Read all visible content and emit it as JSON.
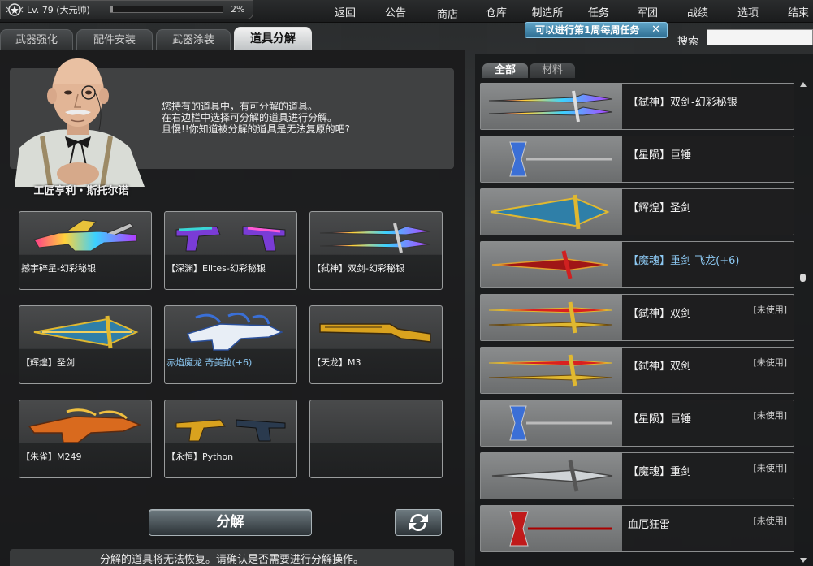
{
  "player": {
    "level": "Lv. 79 (大元帅)",
    "xp_progress": 0.02,
    "xp_text": "2%"
  },
  "nav": {
    "items": [
      {
        "label": "返回",
        "icon": "back-icon"
      },
      {
        "label": "公告",
        "icon": "notice-icon"
      },
      {
        "label": "商店",
        "icon": "shop-icon"
      },
      {
        "label": "仓库",
        "icon": "warehouse-icon"
      },
      {
        "label": "制造所",
        "icon": "factory-icon"
      },
      {
        "label": "任务",
        "icon": "mission-icon"
      },
      {
        "label": "军团",
        "icon": "clan-icon"
      },
      {
        "label": "战绩",
        "icon": "record-icon"
      },
      {
        "label": "选项",
        "icon": "options-icon"
      },
      {
        "label": "结束",
        "icon": "exit-icon"
      }
    ]
  },
  "tabs": [
    {
      "label": "武器强化"
    },
    {
      "label": "配件安装"
    },
    {
      "label": "武器涂装"
    },
    {
      "label": "道具分解",
      "active": true
    }
  ],
  "quest_banner": {
    "text": "可以进行第1周每周任务",
    "close": "✕"
  },
  "search": {
    "label": "搜索",
    "value": "",
    "placeholder": ""
  },
  "npc": {
    "name": "工匠亨利・斯托尔诺",
    "lines": [
      "您持有的道具中，有可分解的道具。",
      "在右边栏中选择可分解的道具进行分解。",
      "且慢!!你知道被分解的道具是无法复原的吧?"
    ]
  },
  "slots": [
    {
      "label": "撼宇碎星-幻彩秘银",
      "art": "rifle-rainbow"
    },
    {
      "label": "【深渊】Elites-幻彩秘银",
      "art": "dual-pistols"
    },
    {
      "label": "【弑神】双剑-幻彩秘银",
      "art": "dual-swords"
    },
    {
      "label": "【辉煌】圣剑",
      "art": "holy-sword"
    },
    {
      "label": "赤焰魔龙 奇美拉(+6)",
      "art": "chimera",
      "highlight": true
    },
    {
      "label": "【天龙】M3",
      "art": "shotgun-gold"
    },
    {
      "label": "【朱雀】M249",
      "art": "mg-phoenix"
    },
    {
      "label": "【永恒】Python",
      "art": "revolvers"
    },
    {
      "label": "",
      "art": ""
    }
  ],
  "buttons": {
    "decompose": "分解",
    "refresh_icon": "refresh-icon"
  },
  "bottom_note": "分解的道具将无法恢复。请确认是否需要进行分解操作。",
  "right": {
    "tabs": [
      {
        "label": "全部",
        "active": true
      },
      {
        "label": "材料"
      }
    ],
    "items": [
      {
        "name": "【弑神】双剑-幻彩秘银",
        "status": "",
        "art": "dual-swords"
      },
      {
        "name": "【星陨】巨锤",
        "status": "",
        "art": "hammer"
      },
      {
        "name": "【辉煌】圣剑",
        "status": "",
        "art": "holy-sword"
      },
      {
        "name": "【魔魂】重剑 飞龙(+6)",
        "status": "",
        "art": "red-sword",
        "highlight": true
      },
      {
        "name": "【弑神】双剑",
        "status": "[未使用]",
        "art": "gold-dual-swords"
      },
      {
        "name": "【弑神】双剑",
        "status": "[未使用]",
        "art": "gold-dual-swords"
      },
      {
        "name": "【星陨】巨锤",
        "status": "[未使用]",
        "art": "hammer"
      },
      {
        "name": "【魔魂】重剑",
        "status": "[未使用]",
        "art": "silver-sword"
      },
      {
        "name": "血厄狂雷",
        "status": "[未使用]",
        "art": "red-hammer"
      }
    ]
  }
}
